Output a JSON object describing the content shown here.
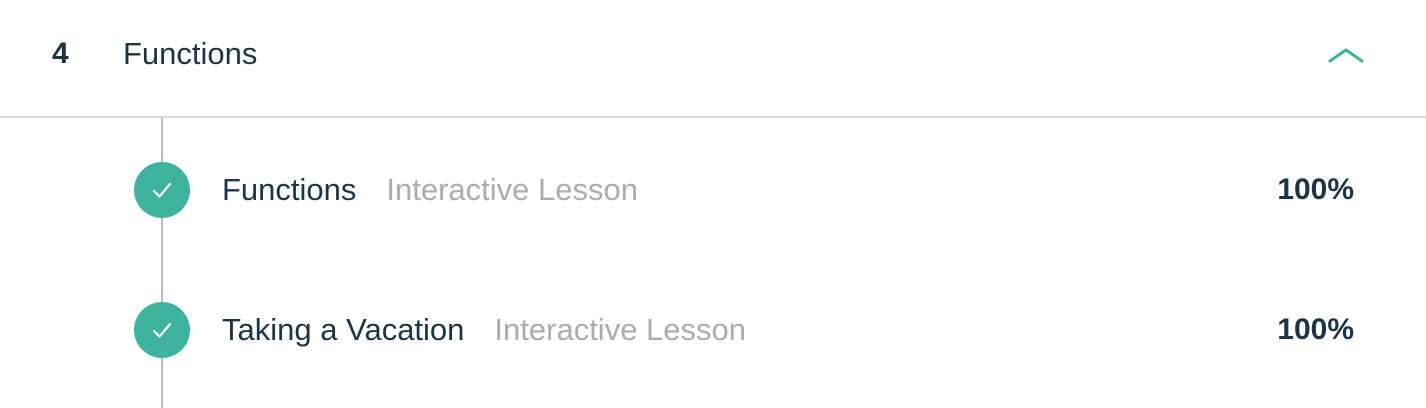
{
  "module": {
    "number": "4",
    "title": "Functions",
    "expanded": true,
    "toggle_icon": "chevron-up-icon",
    "accent_color": "#3db39e"
  },
  "lessons": [
    {
      "title": "Functions",
      "type": "Interactive Lesson",
      "progress": "100%",
      "status_icon": "check-circle-icon",
      "completed": true
    },
    {
      "title": "Taking a Vacation",
      "type": "Interactive Lesson",
      "progress": "100%",
      "status_icon": "check-circle-icon",
      "completed": true
    }
  ],
  "colors": {
    "text_primary": "#1d3447",
    "text_muted": "#a9adb1",
    "complete": "#3db39e",
    "divider": "#d8dbde"
  }
}
